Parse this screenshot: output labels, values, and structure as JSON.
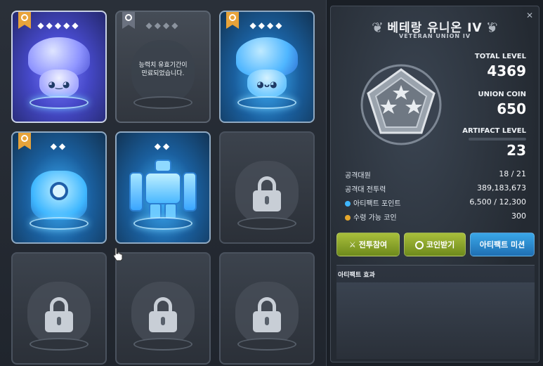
{
  "cards": [
    {
      "id": "card-1",
      "state": "active-purple",
      "stars": "◆◆◆◆◆",
      "ribbon": "gold"
    },
    {
      "id": "card-2",
      "state": "expired",
      "stars": "◆◆◆◆",
      "ribbon": "gray",
      "message": "능력치 유효기간이\n만료되었습니다."
    },
    {
      "id": "card-3",
      "state": "active-blue",
      "stars": "◆◆◆◆",
      "ribbon": "gold"
    },
    {
      "id": "card-4",
      "state": "active-blue",
      "stars": "◆◆",
      "ribbon": "gold"
    },
    {
      "id": "card-5",
      "state": "active-blue",
      "stars": "◆◆",
      "ribbon": "none"
    },
    {
      "id": "card-6",
      "state": "locked"
    },
    {
      "id": "card-7",
      "state": "locked"
    },
    {
      "id": "card-8",
      "state": "locked"
    },
    {
      "id": "card-9",
      "state": "locked"
    }
  ],
  "union": {
    "title": "베테랑 유니온 IV",
    "subtitle": "VETERAN UNION IV"
  },
  "stats": {
    "total_level_label": "TOTAL LEVEL",
    "total_level": "4369",
    "union_coin_label": "UNION COIN",
    "union_coin": "650",
    "artifact_level_label": "ARTIFACT LEVEL",
    "artifact_level": "23",
    "artifact_progress": 0.0
  },
  "info": {
    "raid_members_label": "공격대원",
    "raid_members": "18 / 21",
    "raid_power_label": "공격대 전투력",
    "raid_power": "389,183,673",
    "artifact_points_label": "아티팩트 포인트",
    "artifact_points": "6,500 / 12,300",
    "receivable_coin_label": "수령 가능 코인",
    "receivable_coin": "300"
  },
  "buttons": {
    "battle": "전투참여",
    "coin": "코인받기",
    "mission": "아티팩트 미션"
  },
  "effect": {
    "title": "아티팩트 효과"
  },
  "colors": {
    "gold_ribbon": "#e7a33a",
    "green_button": "#8aa42a",
    "blue_button": "#2f8fd6",
    "point_gem": "#3fb6ff",
    "coin_dot": "#e5a72c"
  }
}
